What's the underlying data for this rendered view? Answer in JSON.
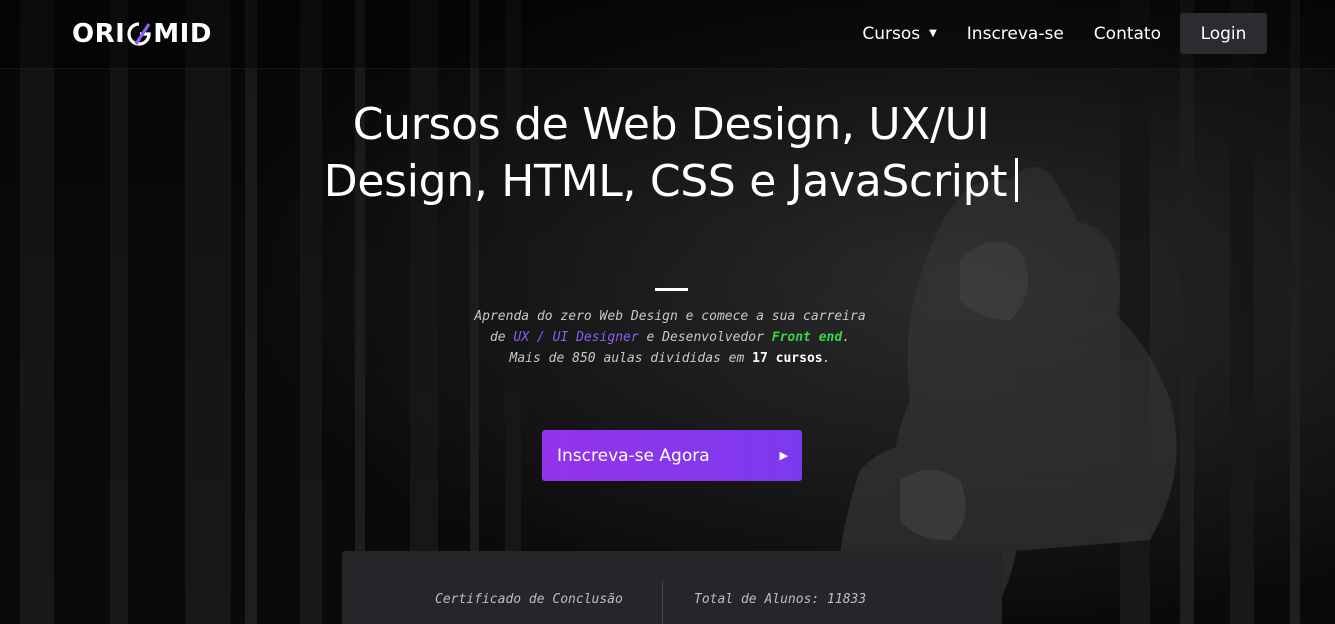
{
  "brand": {
    "logo_left": "ORI",
    "logo_right": "MID",
    "accent": "#8b5cf6"
  },
  "nav": {
    "cursos": "Cursos",
    "cursos_caret": "▼",
    "inscreva": "Inscreva-se",
    "contato": "Contato",
    "login": "Login"
  },
  "hero": {
    "title": "Cursos de Web Design, UX/UI Design, HTML, CSS e JavaScript",
    "subtitle_line1": "Aprenda do zero Web Design e comece a sua carreira",
    "subtitle_line2_a": "de ",
    "subtitle_line2_ux": "UX / UI Designer",
    "subtitle_line2_b": " e Desenvolvedor ",
    "subtitle_line2_fe": "Front end",
    "subtitle_line2_c": ".",
    "subtitle_line3_a": "Mais de 850 aulas divididas em ",
    "subtitle_line3_count": "17 cursos",
    "subtitle_line3_b": ".",
    "cta_label": "Inscreva-se Agora",
    "cta_arrow": "▶",
    "cta_color": "#9333ea"
  },
  "stats": {
    "certificado": "Certificado de Conclusão",
    "total_alunos": "Total de Alunos: 11833"
  }
}
